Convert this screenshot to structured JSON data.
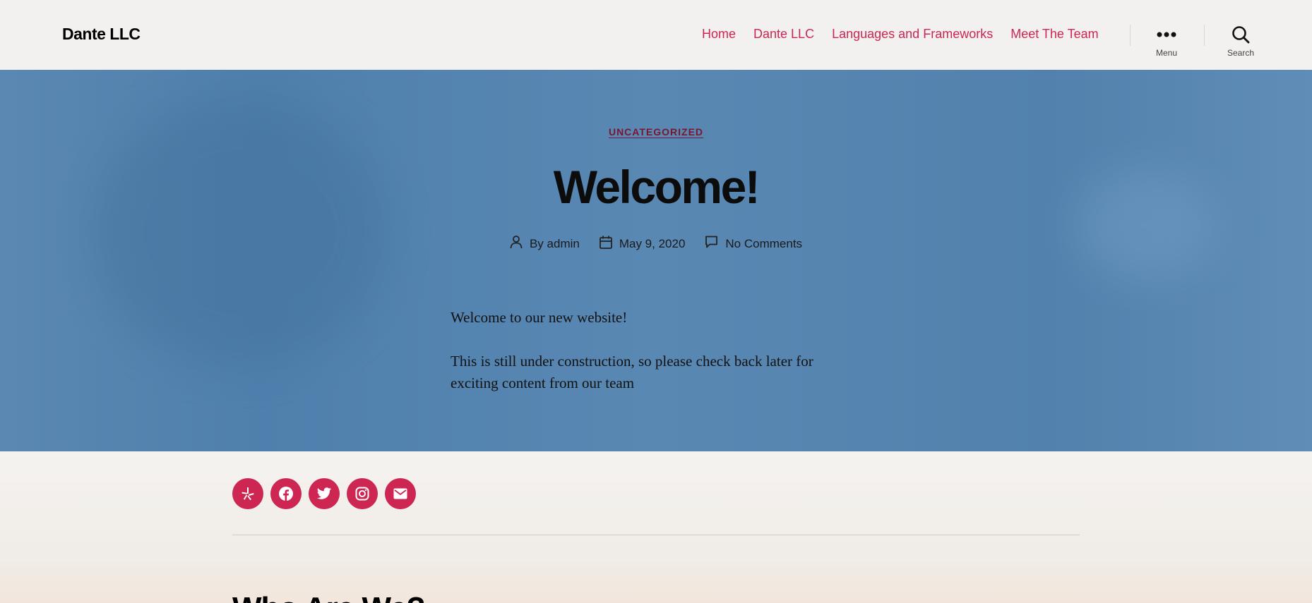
{
  "header": {
    "site_title": "Dante LLC",
    "nav": [
      "Home",
      "Dante LLC",
      "Languages and Frameworks",
      "Meet The Team"
    ],
    "menu_label": "Menu",
    "search_label": "Search"
  },
  "post": {
    "category": "UNCATEGORIZED",
    "title": "Welcome!",
    "author_prefix": "By",
    "author": "admin",
    "date": "May 9, 2020",
    "comments": "No Comments",
    "paragraphs": [
      "Welcome to our new website!",
      "This is still under construction, so please check back later for exciting content from our team"
    ]
  },
  "social": {
    "icons": [
      "yelp-icon",
      "facebook-icon",
      "twitter-icon",
      "instagram-icon",
      "mail-icon"
    ]
  },
  "next_section": {
    "heading": "Who Are We?"
  },
  "colors": {
    "accent": "#cd2653",
    "hero_bg": "#5585b0"
  }
}
